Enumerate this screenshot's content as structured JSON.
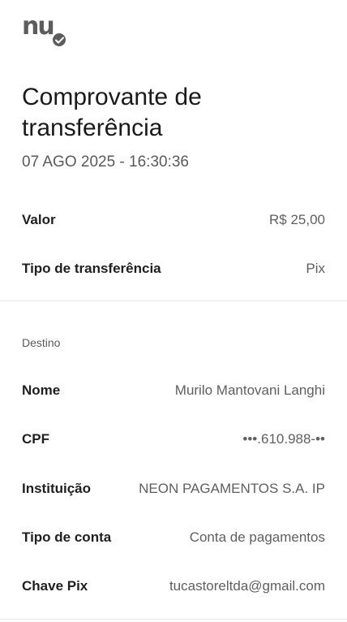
{
  "logo": {
    "text": "nu",
    "badge_icon": "check-icon"
  },
  "header": {
    "title": "Comprovante de transferência",
    "datetime": "07 AGO 2025 - 16:30:36"
  },
  "summary": [
    {
      "label": "Valor",
      "value": "R$ 25,00"
    },
    {
      "label": "Tipo de transferência",
      "value": "Pix"
    }
  ],
  "destino": {
    "section_label": "Destino",
    "rows": [
      {
        "label": "Nome",
        "value": "Murilo Mantovani Langhi"
      },
      {
        "label": "CPF",
        "value": "•••.610.988-••"
      },
      {
        "label": "Instituição",
        "value": "NEON PAGAMENTOS S.A. IP"
      },
      {
        "label": "Tipo de conta",
        "value": "Conta de pagamentos"
      },
      {
        "label": "Chave Pix",
        "value": "tucastoreltda@gmail.com"
      }
    ]
  },
  "colors": {
    "text_primary": "#1f1f1f",
    "text_secondary": "#5f5f5f",
    "logo": "#5c5c5c",
    "divider": "#e6e6e6"
  }
}
